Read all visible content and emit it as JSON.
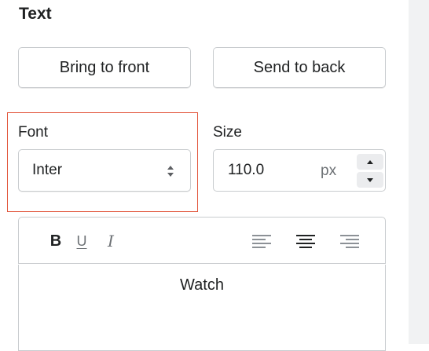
{
  "panel": {
    "section_title": "Text"
  },
  "layer_buttons": {
    "bring_to_front": "Bring to front",
    "send_to_back": "Send to back"
  },
  "font": {
    "label": "Font",
    "value": "Inter"
  },
  "size": {
    "label": "Size",
    "value": "110.0",
    "unit": "px"
  },
  "toolbar": {
    "bold": "B",
    "underline": "U",
    "italic": "I",
    "alignment_selected": "center"
  },
  "editor": {
    "content": "Watch"
  },
  "colors": {
    "highlight_border": "#e2553b",
    "border": "#c9cccf",
    "text": "#202223",
    "muted": "#6d7175"
  }
}
